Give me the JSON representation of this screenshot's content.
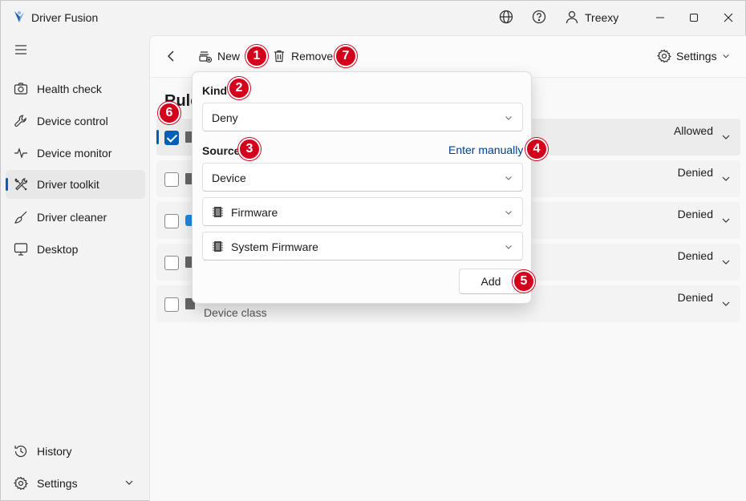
{
  "app": {
    "title": "Driver Fusion",
    "user": "Treexy"
  },
  "sidebar": {
    "items": [
      {
        "label": "Health check",
        "icon": "camera-icon"
      },
      {
        "label": "Device control",
        "icon": "wrench-icon"
      },
      {
        "label": "Device monitor",
        "icon": "pulse-icon"
      },
      {
        "label": "Driver toolkit",
        "icon": "tools-icon",
        "active": true
      },
      {
        "label": "Driver cleaner",
        "icon": "broom-icon"
      },
      {
        "label": "Desktop",
        "icon": "monitor-icon"
      }
    ],
    "bottom": [
      {
        "label": "History",
        "icon": "history-icon"
      },
      {
        "label": "Settings",
        "icon": "gear-icon"
      }
    ]
  },
  "toolbar": {
    "new_label": "New",
    "remove_label": "Remove",
    "settings_label": "Settings"
  },
  "page": {
    "heading": "Rule"
  },
  "rules": [
    {
      "status": "Allowed",
      "checked": true
    },
    {
      "status": "Denied",
      "checked": false
    },
    {
      "status": "Denied",
      "checked": false
    },
    {
      "status": "Denied",
      "checked": false
    },
    {
      "status": "Denied",
      "checked": false,
      "sub": "Device class"
    }
  ],
  "popup": {
    "kind_label": "Kind",
    "kind_value": "Deny",
    "source_label": "Source",
    "enter_manually": "Enter manually",
    "source_value": "Device",
    "device_type": "Firmware",
    "device_name": "System Firmware",
    "add_label": "Add"
  },
  "badges": [
    "1",
    "2",
    "3",
    "4",
    "5",
    "6",
    "7"
  ],
  "colors": {
    "accent": "#005fb8",
    "badge": "#d3001c",
    "link": "#003e92"
  }
}
